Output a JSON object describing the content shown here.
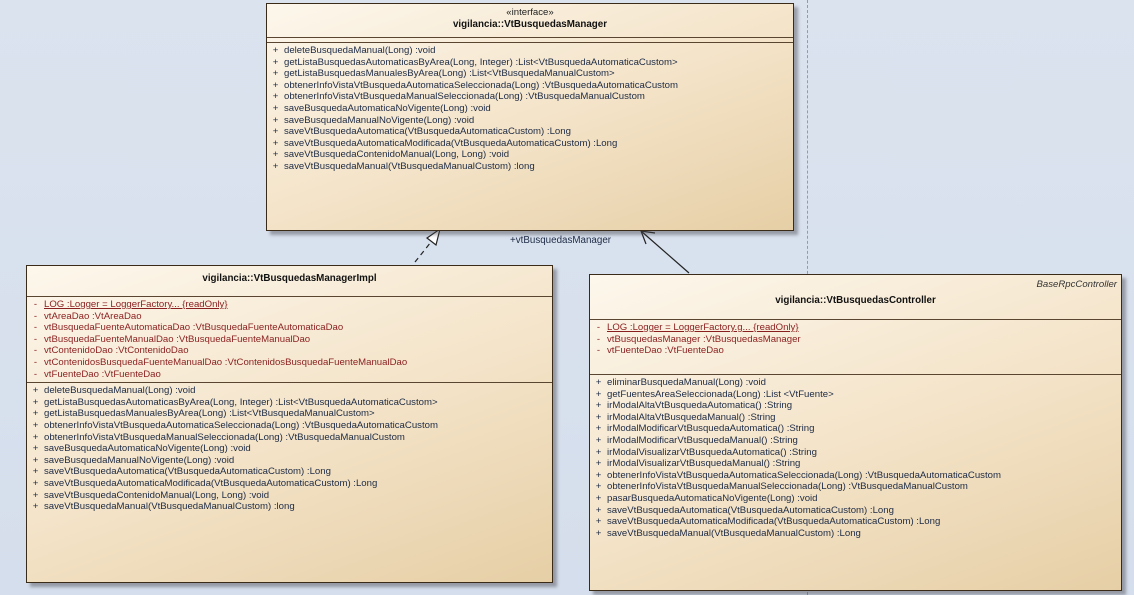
{
  "interface": {
    "stereotype": "«interface»",
    "name": "vigilancia::VtBusquedasManager",
    "operations": [
      {
        "vis": "+",
        "text": "deleteBusquedaManual(Long)  :void"
      },
      {
        "vis": "+",
        "text": "getListaBusquedasAutomaticasByArea(Long, Integer)  :List<VtBusquedaAutomaticaCustom>"
      },
      {
        "vis": "+",
        "text": "getListaBusquedasManualesByArea(Long)  :List<VtBusquedaManualCustom>"
      },
      {
        "vis": "+",
        "text": "obtenerInfoVistaVtBusquedaAutomaticaSeleccionada(Long)  :VtBusquedaAutomaticaCustom"
      },
      {
        "vis": "+",
        "text": "obtenerInfoVistaVtBusquedaManualSeleccionada(Long)  :VtBusquedaManualCustom"
      },
      {
        "vis": "+",
        "text": "saveBusquedaAutomaticaNoVigente(Long)  :void"
      },
      {
        "vis": "+",
        "text": "saveBusquedaManualNoVigente(Long)  :void"
      },
      {
        "vis": "+",
        "text": "saveVtBusquedaAutomatica(VtBusquedaAutomaticaCustom)  :Long"
      },
      {
        "vis": "+",
        "text": "saveVtBusquedaAutomaticaModificada(VtBusquedaAutomaticaCustom)  :Long"
      },
      {
        "vis": "+",
        "text": "saveVtBusquedaContenidoManual(Long, Long)  :void"
      },
      {
        "vis": "+",
        "text": "saveVtBusquedaManual(VtBusquedaManualCustom)  :long"
      }
    ]
  },
  "impl": {
    "name": "vigilancia::VtBusquedasManagerImpl",
    "attributes": [
      {
        "vis": "-",
        "text": "LOG  :Logger = LoggerFactory... {readOnly}",
        "static": true
      },
      {
        "vis": "-",
        "text": "vtAreaDao  :VtAreaDao"
      },
      {
        "vis": "-",
        "text": "vtBusquedaFuenteAutomaticaDao  :VtBusquedaFuenteAutomaticaDao"
      },
      {
        "vis": "-",
        "text": "vtBusquedaFuenteManualDao  :VtBusquedaFuenteManualDao"
      },
      {
        "vis": "-",
        "text": "vtContenidoDao  :VtContenidoDao"
      },
      {
        "vis": "-",
        "text": "vtContenidosBusquedaFuenteManualDao  :VtContenidosBusquedaFuenteManualDao"
      },
      {
        "vis": "-",
        "text": "vtFuenteDao  :VtFuenteDao"
      }
    ],
    "operations": [
      {
        "vis": "+",
        "text": "deleteBusquedaManual(Long)  :void"
      },
      {
        "vis": "+",
        "text": "getListaBusquedasAutomaticasByArea(Long, Integer)  :List<VtBusquedaAutomaticaCustom>"
      },
      {
        "vis": "+",
        "text": "getListaBusquedasManualesByArea(Long)  :List<VtBusquedaManualCustom>"
      },
      {
        "vis": "+",
        "text": "obtenerInfoVistaVtBusquedaAutomaticaSeleccionada(Long)  :VtBusquedaAutomaticaCustom"
      },
      {
        "vis": "+",
        "text": "obtenerInfoVistaVtBusquedaManualSeleccionada(Long)  :VtBusquedaManualCustom"
      },
      {
        "vis": "+",
        "text": "saveBusquedaAutomaticaNoVigente(Long)  :void"
      },
      {
        "vis": "+",
        "text": "saveBusquedaManualNoVigente(Long)  :void"
      },
      {
        "vis": "+",
        "text": "saveVtBusquedaAutomatica(VtBusquedaAutomaticaCustom)  :Long"
      },
      {
        "vis": "+",
        "text": "saveVtBusquedaAutomaticaModificada(VtBusquedaAutomaticaCustom)  :Long"
      },
      {
        "vis": "+",
        "text": "saveVtBusquedaContenidoManual(Long, Long)  :void"
      },
      {
        "vis": "+",
        "text": "saveVtBusquedaManual(VtBusquedaManualCustom)  :long"
      }
    ]
  },
  "controller": {
    "parent": "BaseRpcController",
    "name": "vigilancia::VtBusquedasController",
    "attributes": [
      {
        "vis": "-",
        "text": "LOG  :Logger = LoggerFactory.g... {readOnly}",
        "static": true
      },
      {
        "vis": "-",
        "text": "vtBusquedasManager  :VtBusquedasManager"
      },
      {
        "vis": "-",
        "text": "vtFuenteDao  :VtFuenteDao"
      }
    ],
    "operations": [
      {
        "vis": "+",
        "text": "eliminarBusquedaManual(Long)  :void"
      },
      {
        "vis": "+",
        "text": "getFuentesAreaSeleccionada(Long)  :List <VtFuente>"
      },
      {
        "vis": "+",
        "text": "irModalAltaVtBusquedaAutomatica()  :String"
      },
      {
        "vis": "+",
        "text": "irModalAltaVtBusquedaManual()  :String"
      },
      {
        "vis": "+",
        "text": "irModalModificarVtBusquedaAutomatica()  :String"
      },
      {
        "vis": "+",
        "text": "irModalModificarVtBusquedaManual()  :String"
      },
      {
        "vis": "+",
        "text": "irModalVisualizarVtBusquedaAutomatica()  :String"
      },
      {
        "vis": "+",
        "text": "irModalVisualizarVtBusquedaManual()  :String"
      },
      {
        "vis": "+",
        "text": "obtenerInfoVistaVtBusquedaAutomaticaSeleccionada(Long)  :VtBusquedaAutomaticaCustom"
      },
      {
        "vis": "+",
        "text": "obtenerInfoVistaVtBusquedaManualSeleccionada(Long)  :VtBusquedaManualCustom"
      },
      {
        "vis": "+",
        "text": "pasarBusquedaAutomaticaNoVigente(Long)  :void"
      },
      {
        "vis": "+",
        "text": "saveVtBusquedaAutomatica(VtBusquedaAutomaticaCustom)  :Long"
      },
      {
        "vis": "+",
        "text": "saveVtBusquedaAutomaticaModificada(VtBusquedaAutomaticaCustom)  :Long"
      },
      {
        "vis": "+",
        "text": "saveVtBusquedaManual(VtBusquedaManualCustom)  :Long"
      }
    ]
  },
  "association_label": "+vtBusquedasManager"
}
